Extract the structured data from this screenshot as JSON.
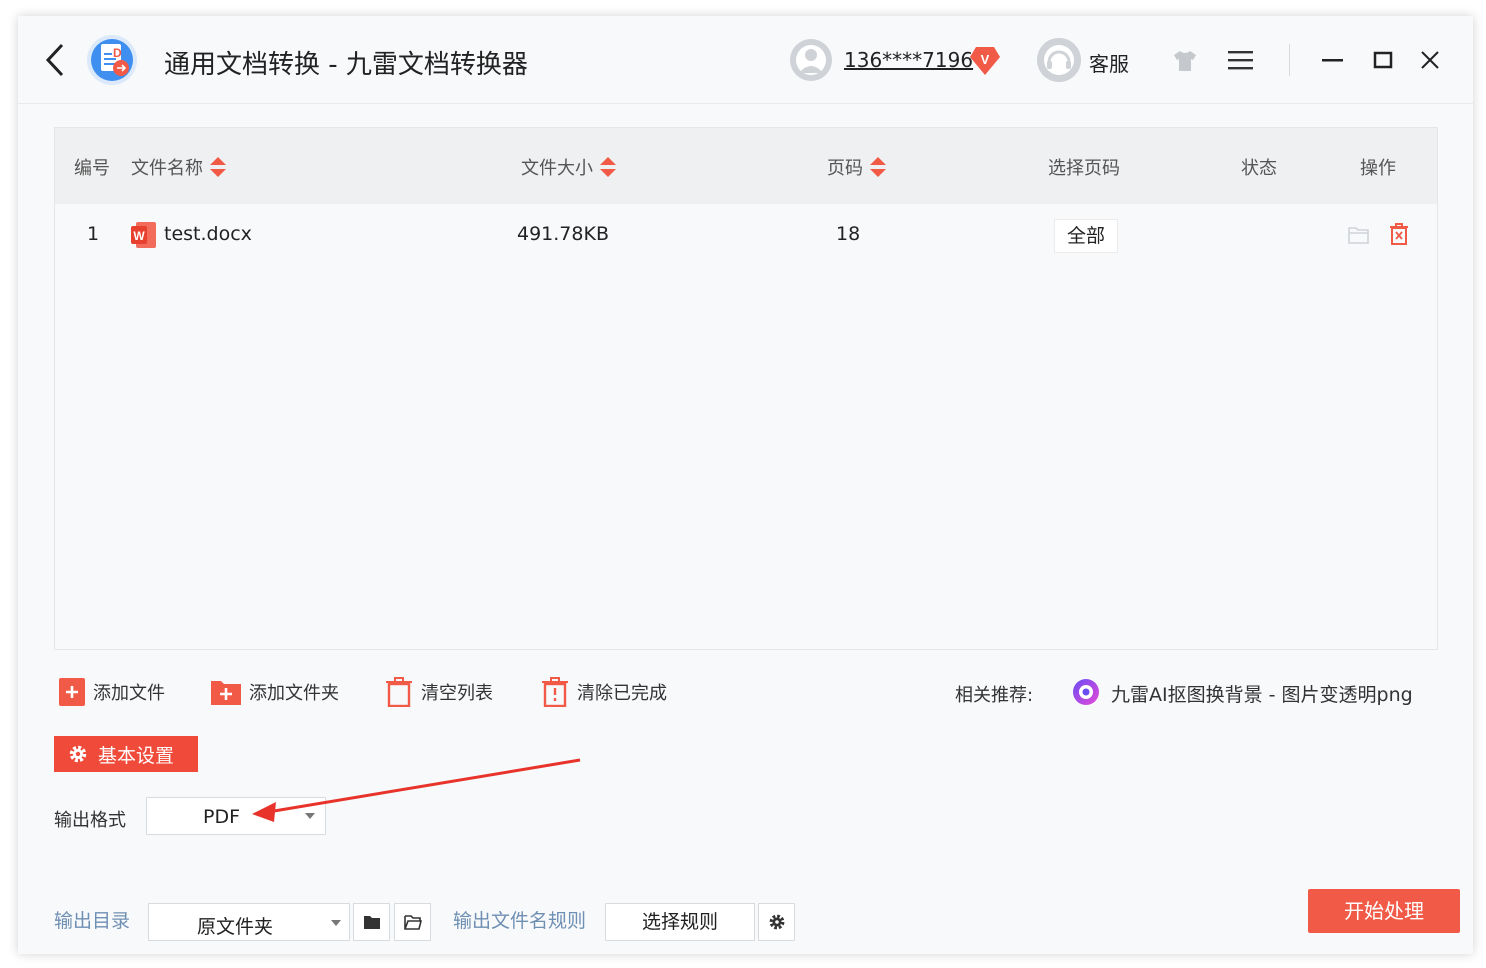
{
  "titlebar": {
    "title": "通用文档转换 - 九雷文档转换器",
    "user_name": "136****7196",
    "vip_badge": "V",
    "service_label": "客服",
    "icons": [
      "back-arrow-icon",
      "app-logo-icon",
      "user-avatar-icon",
      "vip-badge-icon",
      "headset-avatar-icon",
      "shirt-skin-icon",
      "hamburger-menu-icon",
      "minimize-icon",
      "maximize-icon",
      "close-icon"
    ]
  },
  "table": {
    "headers": {
      "index": "编号",
      "name": "文件名称",
      "size": "文件大小",
      "pages": "页码",
      "select_pages": "选择页码",
      "status": "状态",
      "actions": "操作"
    },
    "rows": [
      {
        "index": "1",
        "name": "test.docx",
        "size": "491.78KB",
        "pages": "18",
        "select_pages": "全部",
        "status": ""
      }
    ]
  },
  "toolbar": {
    "add_file": "添加文件",
    "add_folder": "添加文件夹",
    "clear_list": "清空列表",
    "clear_done": "清除已完成",
    "recommend_label": "相关推荐:",
    "recommend_link": "九雷AI抠图换背景 - 图片变透明png"
  },
  "settings": {
    "tab_label": "基本设置",
    "format_label": "输出格式",
    "format_value": "PDF"
  },
  "bottom": {
    "output_dir_label": "输出目录",
    "output_dir_value": "原文件夹",
    "filename_rule_label": "输出文件名规则",
    "rule_button": "选择规则",
    "start_button": "开始处理"
  },
  "colors": {
    "accent": "#f04b3a",
    "start_button": "#f05a47",
    "label_blue": "#6f8fb3",
    "header_bg": "#eff0f2",
    "annotation_arrow": "#e8332a"
  }
}
